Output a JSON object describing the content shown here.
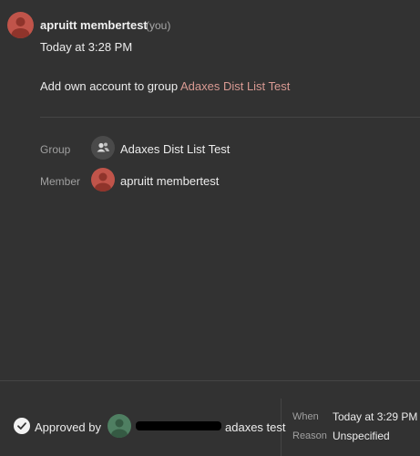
{
  "header": {
    "user_name": "apruitt membertest",
    "you_tag": "(you)",
    "timestamp": "Today at 3:28 PM"
  },
  "message": {
    "text": "Add own account to group",
    "link": "Adaxes Dist List Test"
  },
  "details": {
    "group_label": "Group",
    "group_value": "Adaxes Dist List Test",
    "member_label": "Member",
    "member_value": "apruitt membertest"
  },
  "footer": {
    "approved_by_label": "Approved by",
    "approver_name_suffix": "adaxes test",
    "when_label": "When",
    "when_value": "Today at 3:29 PM",
    "reason_label": "Reason",
    "reason_value": "Unspecified"
  },
  "colors": {
    "background": "#323232",
    "user_avatar": "#c0544a",
    "approver_avatar": "#4f7f62",
    "group_icon_bg": "#4a4a4a",
    "link": "#d99a93"
  },
  "icons": {
    "group": "group-people-icon",
    "user": "user-avatar-icon",
    "approved": "checkmark-circle-icon"
  }
}
